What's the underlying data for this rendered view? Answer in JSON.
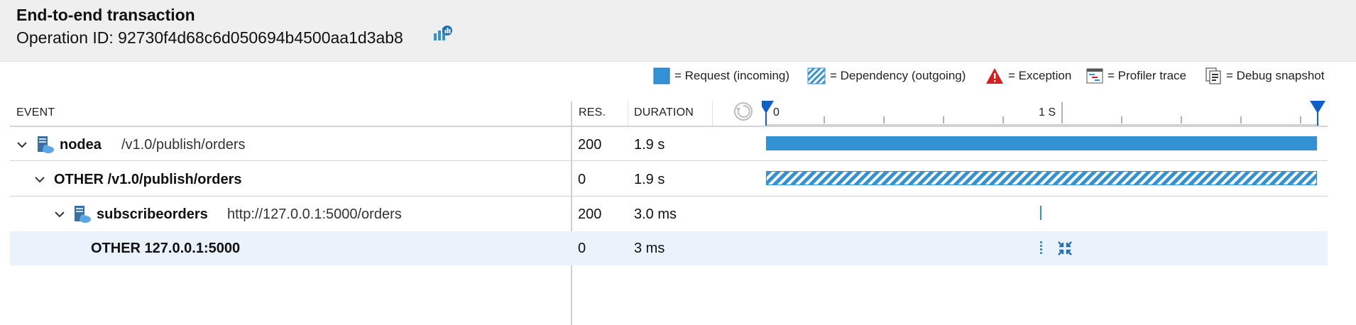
{
  "header": {
    "title": "End-to-end transaction",
    "operation_id_label": "Operation ID: 92730f4d68c6d050694b4500aa1d3ab8"
  },
  "legend": {
    "request": "= Request (incoming)",
    "dependency": "= Dependency (outgoing)",
    "exception": "= Exception",
    "profiler": "= Profiler trace",
    "snapshot": "= Debug snapshot"
  },
  "columns": {
    "event": "EVENT",
    "res": "RES.",
    "duration": "DURATION"
  },
  "timeline": {
    "tick_start": "0",
    "tick_mid": "1 S"
  },
  "rows": [
    {
      "name": "nodea",
      "path": "/v1.0/publish/orders",
      "res": "200",
      "duration": "1.9 s"
    },
    {
      "name": "OTHER /v1.0/publish/orders",
      "res": "0",
      "duration": "1.9 s"
    },
    {
      "name": "subscribeorders",
      "path": "http://127.0.0.1:5000/orders",
      "res": "200",
      "duration": "3.0 ms"
    },
    {
      "name": "OTHER 127.0.0.1:5000",
      "res": "0",
      "duration": "3 ms"
    }
  ],
  "colors": {
    "accent": "#3392d4",
    "marker": "#0f5fc9",
    "exception": "#d81d1d",
    "selected_row": "#eaf3fb"
  }
}
